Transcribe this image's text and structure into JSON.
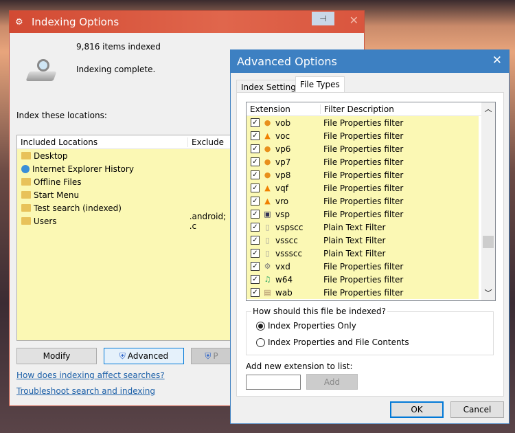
{
  "indexing": {
    "title": "Indexing Options",
    "items_indexed": "9,816 items indexed",
    "status": "Indexing complete.",
    "locations_label": "Index these locations:",
    "columns": [
      "Included Locations",
      "Exclude"
    ],
    "locations": [
      {
        "name": "Desktop",
        "exclude": ""
      },
      {
        "name": "Internet Explorer History",
        "exclude": ""
      },
      {
        "name": "Offline Files",
        "exclude": ""
      },
      {
        "name": "Start Menu",
        "exclude": ""
      },
      {
        "name": "Test search (indexed)",
        "exclude": ""
      },
      {
        "name": "Users",
        "exclude": ".android; .c"
      }
    ],
    "buttons": {
      "modify": "Modify",
      "advanced": "Advanced",
      "pause": "P"
    },
    "links": [
      "How does indexing affect searches?",
      "Troubleshoot search and indexing"
    ]
  },
  "advanced": {
    "title": "Advanced Options",
    "tabs": [
      "Index Settings",
      "File Types"
    ],
    "active_tab": "File Types",
    "columns": [
      "Extension",
      "Filter Description"
    ],
    "rows": [
      {
        "ext": "vob",
        "filter": "File Properties filter",
        "icon": "media-disc-icon"
      },
      {
        "ext": "voc",
        "filter": "File Properties filter",
        "icon": "vlc-cone-icon"
      },
      {
        "ext": "vp6",
        "filter": "File Properties filter",
        "icon": "media-disc-icon"
      },
      {
        "ext": "vp7",
        "filter": "File Properties filter",
        "icon": "media-disc-icon"
      },
      {
        "ext": "vp8",
        "filter": "File Properties filter",
        "icon": "media-disc-icon"
      },
      {
        "ext": "vqf",
        "filter": "File Properties filter",
        "icon": "vlc-cone-icon"
      },
      {
        "ext": "vro",
        "filter": "File Properties filter",
        "icon": "vlc-cone-icon"
      },
      {
        "ext": "vsp",
        "filter": "File Properties filter",
        "icon": "image-file-icon"
      },
      {
        "ext": "vspscc",
        "filter": "Plain Text Filter",
        "icon": "blank-file-icon"
      },
      {
        "ext": "vsscc",
        "filter": "Plain Text Filter",
        "icon": "blank-file-icon"
      },
      {
        "ext": "vssscc",
        "filter": "Plain Text Filter",
        "icon": "blank-file-icon"
      },
      {
        "ext": "vxd",
        "filter": "File Properties filter",
        "icon": "settings-file-icon"
      },
      {
        "ext": "w64",
        "filter": "File Properties filter",
        "icon": "audio-file-icon"
      },
      {
        "ext": "wab",
        "filter": "File Properties filter",
        "icon": "address-book-icon"
      }
    ],
    "group_label": "How should this file be indexed?",
    "options": [
      "Index Properties Only",
      "Index Properties and File Contents"
    ],
    "selected_option": "Index Properties Only",
    "add_label": "Add new extension to list:",
    "add_value": "",
    "add_button": "Add",
    "ok": "OK",
    "cancel": "Cancel"
  }
}
